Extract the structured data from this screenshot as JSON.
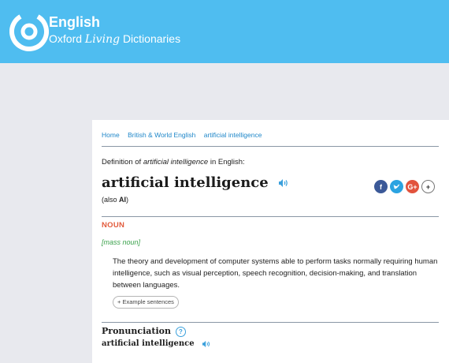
{
  "header": {
    "brand_main": "English",
    "brand_prefix": "Oxford",
    "brand_living": "Living",
    "brand_suffix": "Dictionaries",
    "background": "#4fbdf0"
  },
  "breadcrumb": {
    "items": [
      "Home",
      "British & World English",
      "artificial intelligence"
    ]
  },
  "entry": {
    "definition_of_prefix": "Definition of",
    "definition_of_term": "artificial intelligence",
    "definition_of_suffix": "in English:",
    "headword": "artificial intelligence",
    "also_prefix": "(also",
    "also_value": "AI",
    "also_suffix": ")",
    "part_of_speech": "NOUN",
    "grammar": "[mass noun]",
    "definition": "The theory and development of computer systems able to perform tasks normally requiring human intelligence, such as visual perception, speech recognition, decision-making, and translation between languages.",
    "examples_button": "+ Example sentences"
  },
  "share": {
    "facebook": "f",
    "twitter": "t",
    "google": "G+",
    "more": "+",
    "facebook_color": "#3b5998",
    "twitter_color": "#2ba3e1",
    "google_color": "#e2533d"
  },
  "pronunciation": {
    "title": "Pronunciation",
    "help": "?",
    "word": "artificial intelligence"
  },
  "colors": {
    "link": "#1f87c9",
    "pos": "#e25b3c",
    "grammar": "#3aa14b"
  }
}
